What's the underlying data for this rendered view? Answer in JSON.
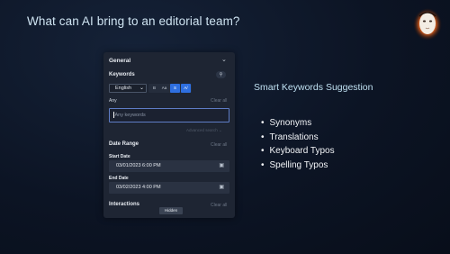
{
  "slide": {
    "title": "What can AI bring to an editorial team?"
  },
  "panel": {
    "section_title": "General",
    "keywords": {
      "label": "Keywords",
      "language": "English",
      "toggles": [
        "B",
        "Aa",
        "S",
        "A/"
      ],
      "active_toggle": "S",
      "match_label": "Any",
      "clear_label": "Clear all",
      "input_placeholder": "Any keywords",
      "advanced_label": "Advanced search"
    },
    "date_range": {
      "label": "Date Range",
      "clear_label": "Clear all",
      "start_label": "Start Date",
      "start_value": "03/01/2023 6:00 PM",
      "end_label": "End Date",
      "end_value": "03/02/2023 4:00 PM"
    },
    "interactions": {
      "label": "Interactions",
      "clear_label": "Clear all",
      "hidden_tag": "Hidden"
    }
  },
  "feature": {
    "title": "Smart Keywords Suggestion",
    "bullets": [
      "Synonyms",
      "Translations",
      "Keyboard Typos",
      "Spelling Typos"
    ]
  },
  "colors": {
    "background": "#0c1424",
    "panel": "#1e2533",
    "accent": "#2e6fe0",
    "title_text": "#cfe4f2"
  },
  "icons": [
    "chevron-down-icon",
    "pin-icon",
    "calendar-icon",
    "logo-face-icon"
  ]
}
